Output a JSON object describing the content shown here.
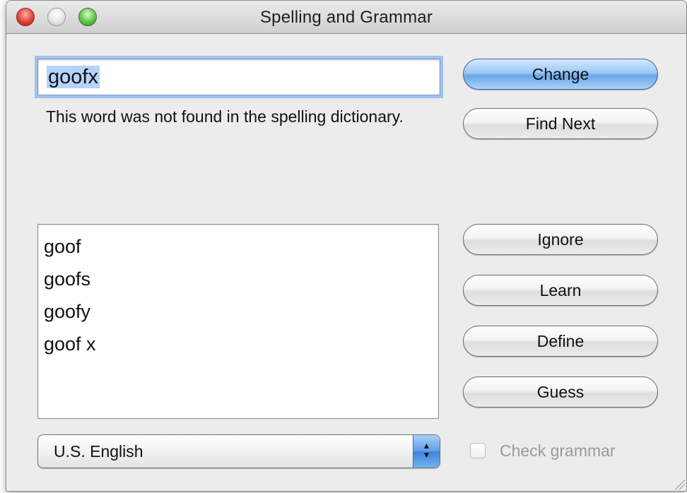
{
  "window": {
    "title": "Spelling and Grammar"
  },
  "spelling": {
    "word": "goofx",
    "message": "This word was not found in the spelling dictionary."
  },
  "guesses": [
    "goof",
    "goofs",
    "goofy",
    "goof x"
  ],
  "buttons": {
    "change": "Change",
    "find_next": "Find Next",
    "ignore": "Ignore",
    "learn": "Learn",
    "define": "Define",
    "guess": "Guess"
  },
  "language": {
    "selected": "U.S. English"
  },
  "grammar": {
    "label": "Check grammar",
    "checked": false
  },
  "icons": {
    "close": "close-icon",
    "minimize": "minimize-icon",
    "zoom": "zoom-icon",
    "select_arrows": "up-down-arrows-icon",
    "resize": "resize-grip-icon"
  },
  "colors": {
    "default_button": "#7ab2ef",
    "focus_ring": "#9fc2ee",
    "selection": "#b5d3fb"
  }
}
